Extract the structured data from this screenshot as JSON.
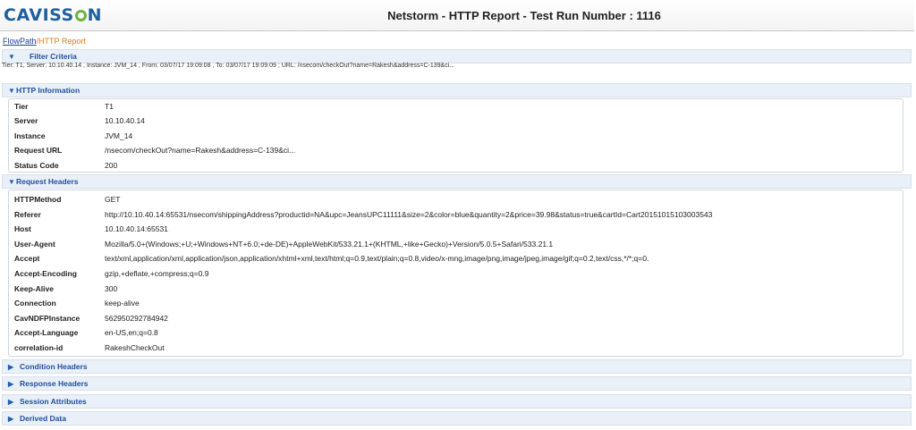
{
  "header": {
    "logo": "CAVISSON",
    "title": "Netstorm - HTTP Report - Test Run Number : 1116"
  },
  "breadcrumb": {
    "link": "FlowPath",
    "separator": "/",
    "current": "HTTP Report"
  },
  "filter": {
    "label": "Filter Criteria",
    "text": "Tier: T1, Server: 10.10.40.14 , Instance: JVM_14 , From: 03/07/17 19:09:08 , To: 03/07/17 19:09:09 ; URL: /nsecom/checkOut?name=Rakesh&address=C-139&ci..."
  },
  "http_information": {
    "label": "HTTP Information",
    "rows": [
      {
        "key": "Tier",
        "value": "T1"
      },
      {
        "key": "Server",
        "value": "10.10.40.14"
      },
      {
        "key": "Instance",
        "value": "JVM_14"
      },
      {
        "key": "Request URL",
        "value": "/nsecom/checkOut?name=Rakesh&address=C-139&ci..."
      },
      {
        "key": "Status Code",
        "value": "200"
      }
    ]
  },
  "request_headers": {
    "label": "Request Headers",
    "rows": [
      {
        "key": "HTTPMethod",
        "value": "GET"
      },
      {
        "key": "Referer",
        "value": "http://10.10.40.14:65531/nsecom/shippingAddress?productid=NA&upc=JeansUPC11111&size=2&color=blue&quantity=2&price=39.98&status=true&cartId=Cart20151015103003543"
      },
      {
        "key": "Host",
        "value": "10.10.40.14:65531"
      },
      {
        "key": "User-Agent",
        "value": "Mozilla/5.0+(Windows;+U;+Windows+NT+6.0;+de-DE)+AppleWebKit/533.21.1+(KHTML,+like+Gecko)+Version/5.0.5+Safari/533.21.1"
      },
      {
        "key": "Accept",
        "value": "text/xml,application/xml,application/json,application/xhtml+xml,text/html;q=0.9,text/plain;q=0.8,video/x-mng,image/png,image/jpeg,image/gif;q=0.2,text/css,*/*;q=0."
      },
      {
        "key": "Accept-Encoding",
        "value": "gzip,+deflate,+compress;q=0.9"
      },
      {
        "key": "Keep-Alive",
        "value": "300"
      },
      {
        "key": "Connection",
        "value": "keep-alive"
      },
      {
        "key": "CavNDFPInstance",
        "value": "562950292784942"
      },
      {
        "key": "Accept-Language",
        "value": "en-US,en;q=0.8"
      },
      {
        "key": "correlation-id",
        "value": "RakeshCheckOut"
      }
    ]
  },
  "collapsed_sections": [
    {
      "label": "Condition Headers"
    },
    {
      "label": "Response Headers"
    },
    {
      "label": "Session Attributes"
    },
    {
      "label": "Derived Data"
    }
  ],
  "icons": {
    "expanded": "triangle-down-icon",
    "collapsed": "triangle-right-icon",
    "accent": "#1f5fb0"
  }
}
